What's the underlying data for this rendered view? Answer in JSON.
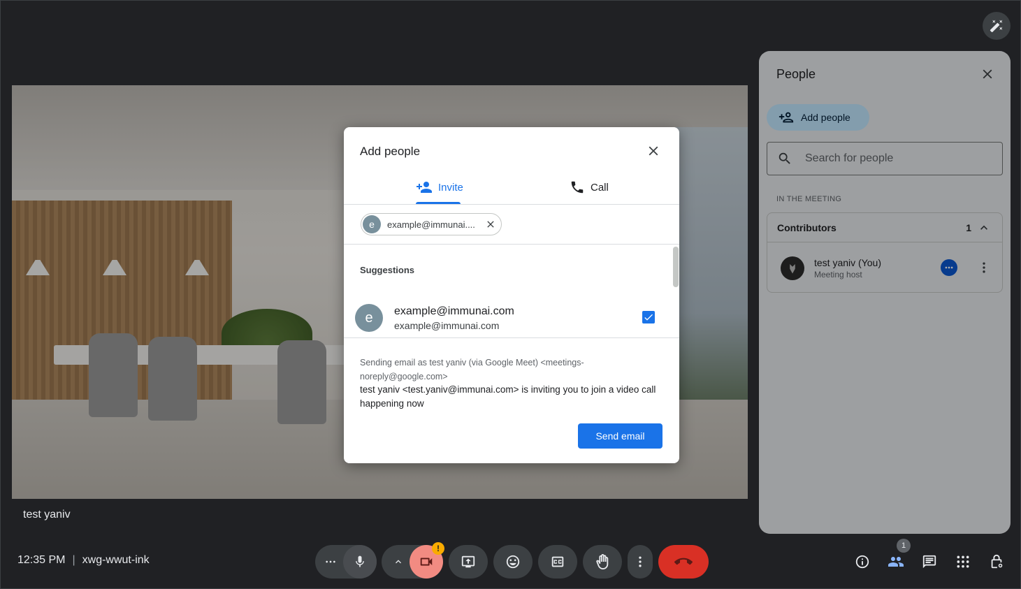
{
  "colors": {
    "accent": "#1a73e8",
    "end_call": "#d93025",
    "camera_off": "#f28b82",
    "warning": "#f9ab00"
  },
  "tile": {
    "participant_name": "test yaniv"
  },
  "meeting": {
    "time": "12:35 PM",
    "separator": "|",
    "code": "xwg-wwut-ink"
  },
  "controls": {
    "camera_warning_badge": "!",
    "people_count": "1",
    "icons": [
      "more-icon",
      "mic-icon",
      "chevron-up-icon",
      "camera-off-icon",
      "present-icon",
      "emoji-icon",
      "captions-icon",
      "raise-hand-icon",
      "more-vert-icon",
      "end-call-icon",
      "info-icon",
      "people-icon",
      "chat-icon",
      "activities-icon",
      "host-controls-icon"
    ]
  },
  "people_panel": {
    "title": "People",
    "add_people_label": "Add people",
    "search_placeholder": "Search for people",
    "section_label": "IN THE MEETING",
    "group": {
      "label": "Contributors",
      "count": "1"
    },
    "participants": [
      {
        "name": "test yaniv (You)",
        "role": "Meeting host"
      }
    ]
  },
  "modal": {
    "title": "Add people",
    "tabs": [
      {
        "label": "Invite",
        "active": true
      },
      {
        "label": "Call",
        "active": false
      }
    ],
    "chip": {
      "initial": "e",
      "text": "example@immunai...."
    },
    "suggestions_title": "Suggestions",
    "suggestions": [
      {
        "initial": "e",
        "name": "example@immunai.com",
        "email": "example@immunai.com",
        "checked": true
      }
    ],
    "sender_line": "Sending email as test yaniv (via Google Meet) <meetings-noreply@google.com>",
    "message": "test yaniv <test.yaniv@immunai.com> is inviting you to join a video call happening now",
    "send_button": "Send email"
  }
}
